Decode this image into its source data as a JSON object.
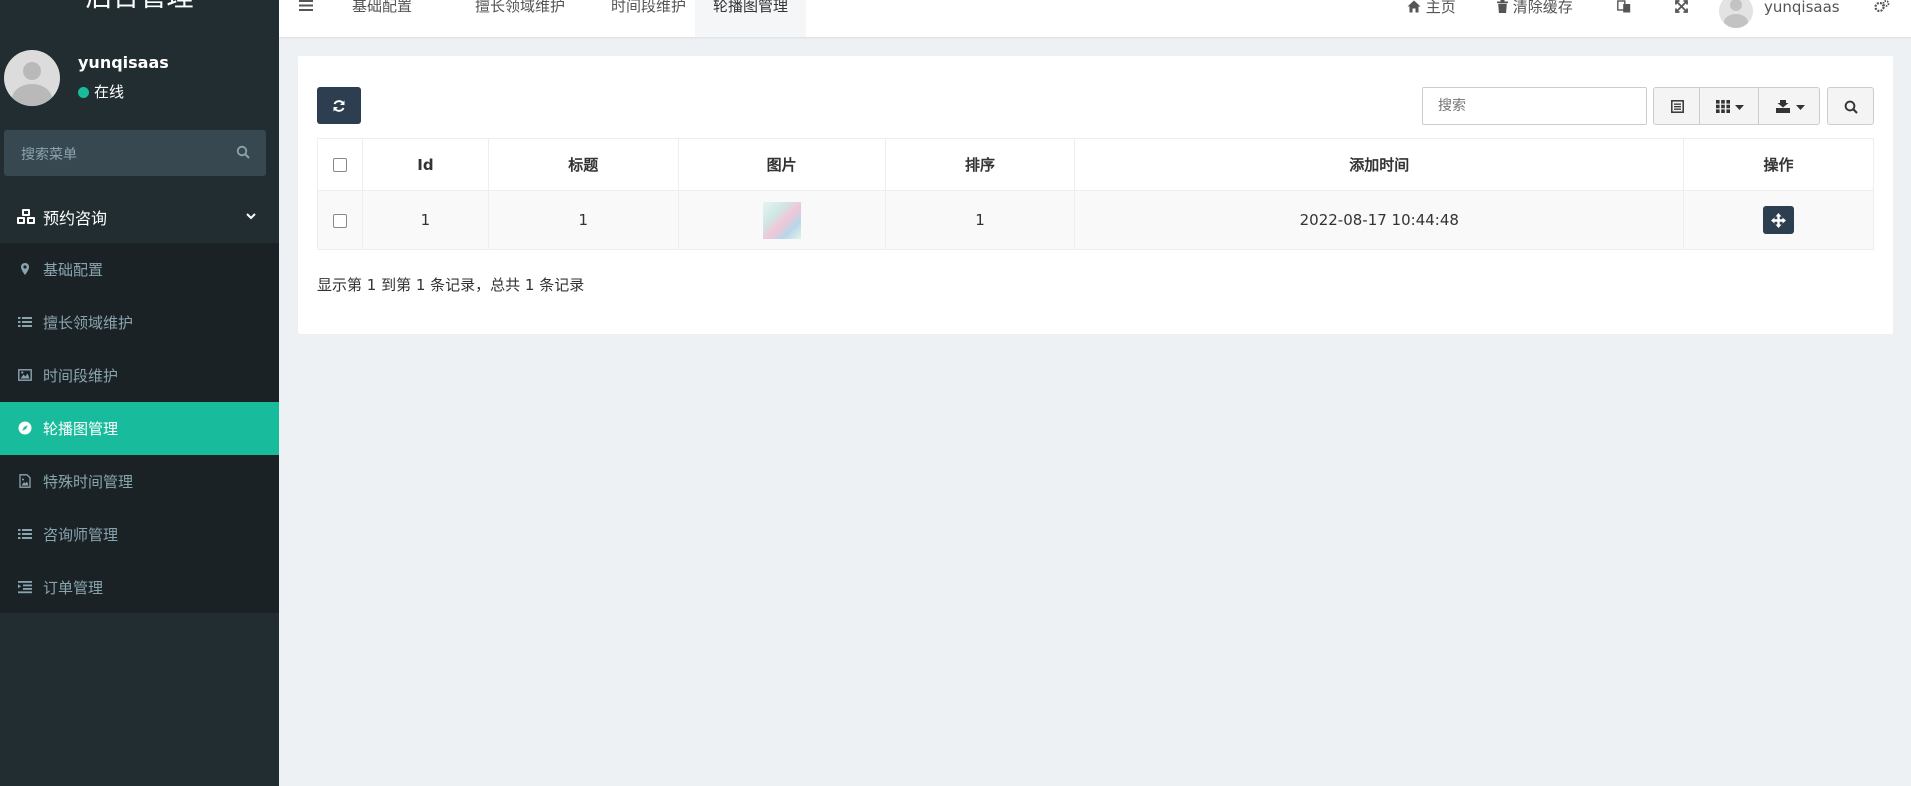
{
  "app": {
    "title": "后台管理"
  },
  "user": {
    "name": "yunqisaas",
    "status": "在线"
  },
  "sidebar": {
    "search_placeholder": "搜索菜单",
    "group_label": "预约咨询",
    "items": [
      {
        "label": "基础配置",
        "icon": "map-marker-icon"
      },
      {
        "label": "擅长领域维护",
        "icon": "list-icon"
      },
      {
        "label": "时间段维护",
        "icon": "image-icon"
      },
      {
        "label": "轮播图管理",
        "icon": "compass-icon",
        "active": true
      },
      {
        "label": "特殊时间管理",
        "icon": "file-image-icon"
      },
      {
        "label": "咨询师管理",
        "icon": "list-icon"
      },
      {
        "label": "订单管理",
        "icon": "indent-icon"
      }
    ]
  },
  "navbar": {
    "tabs": [
      "基础配置",
      "擅长领域维护",
      "时间段维护",
      "轮播图管理"
    ],
    "active_tab": "轮播图管理",
    "home_label": "主页",
    "clear_cache_label": "清除缓存",
    "username": "yunqisaas"
  },
  "toolbar": {
    "search_placeholder": "搜索"
  },
  "table": {
    "columns": [
      "Id",
      "标题",
      "图片",
      "排序",
      "添加时间",
      "操作"
    ],
    "rows": [
      {
        "id": "1",
        "title": "1",
        "sort": "1",
        "created_at": "2022-08-17 10:44:48"
      }
    ]
  },
  "pagination": {
    "summary": "显示第 1 到第 1 条记录，总共 1 条记录"
  },
  "colors": {
    "sidebar_bg": "#222d32",
    "accent": "#18bc9c",
    "primary_btn": "#2c3e50"
  }
}
